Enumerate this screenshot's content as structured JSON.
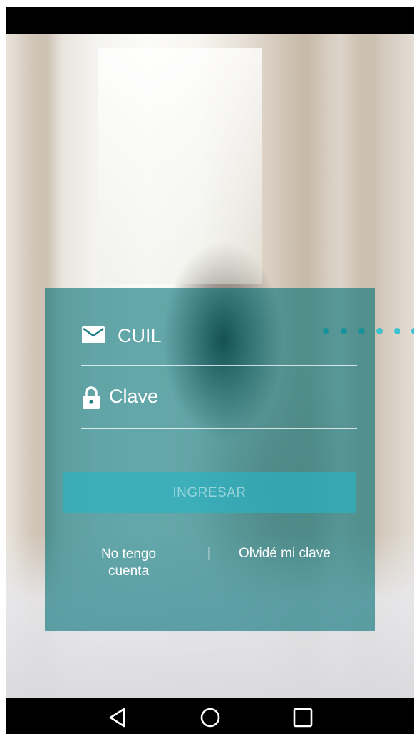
{
  "login": {
    "cuil_placeholder": "CUIL",
    "clave_placeholder": "Clave",
    "submit_label": "INGRESAR",
    "register_link": "No tengo cuenta",
    "separator": "|",
    "forgot_link": "Olvidé mi clave"
  },
  "icons": {
    "cuil": "mail-icon",
    "clave": "lock-icon",
    "nav_back": "back-triangle-icon",
    "nav_home": "home-circle-icon",
    "nav_recents": "recents-square-icon"
  },
  "colors": {
    "card_overlay": "#007076",
    "button": "#28b4c4",
    "indicator_dots": "#3bc3cf",
    "system_bars": "#000000"
  }
}
